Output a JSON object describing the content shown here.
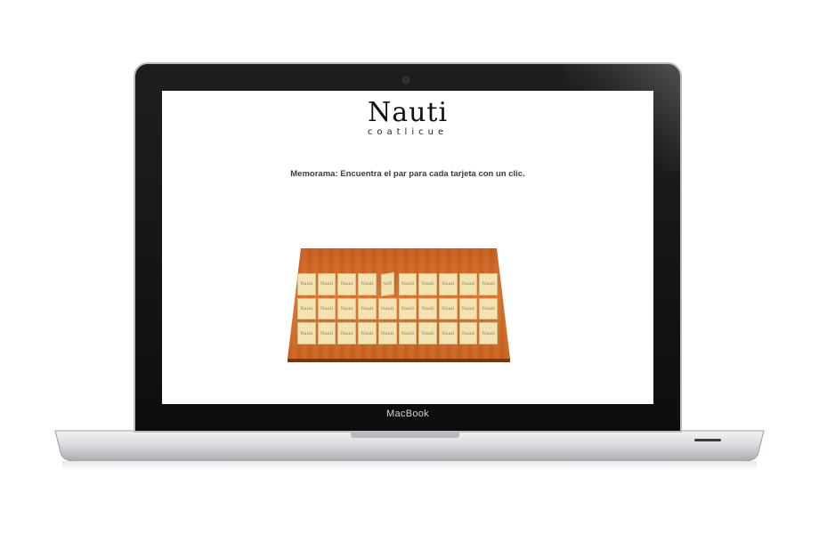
{
  "device": {
    "brand_label": "MacBook"
  },
  "screen": {
    "logo": {
      "word": "Nauti",
      "sub": "coatlicue"
    },
    "instruction": "Memorama: Encuentra el par para cada tarjeta con un clic.",
    "game": {
      "rows": 3,
      "columns": 10,
      "card_label": "Nauti"
    }
  },
  "colors": {
    "board": "#d26a26",
    "card": "#f3e3b3",
    "bezel": "#111111"
  }
}
